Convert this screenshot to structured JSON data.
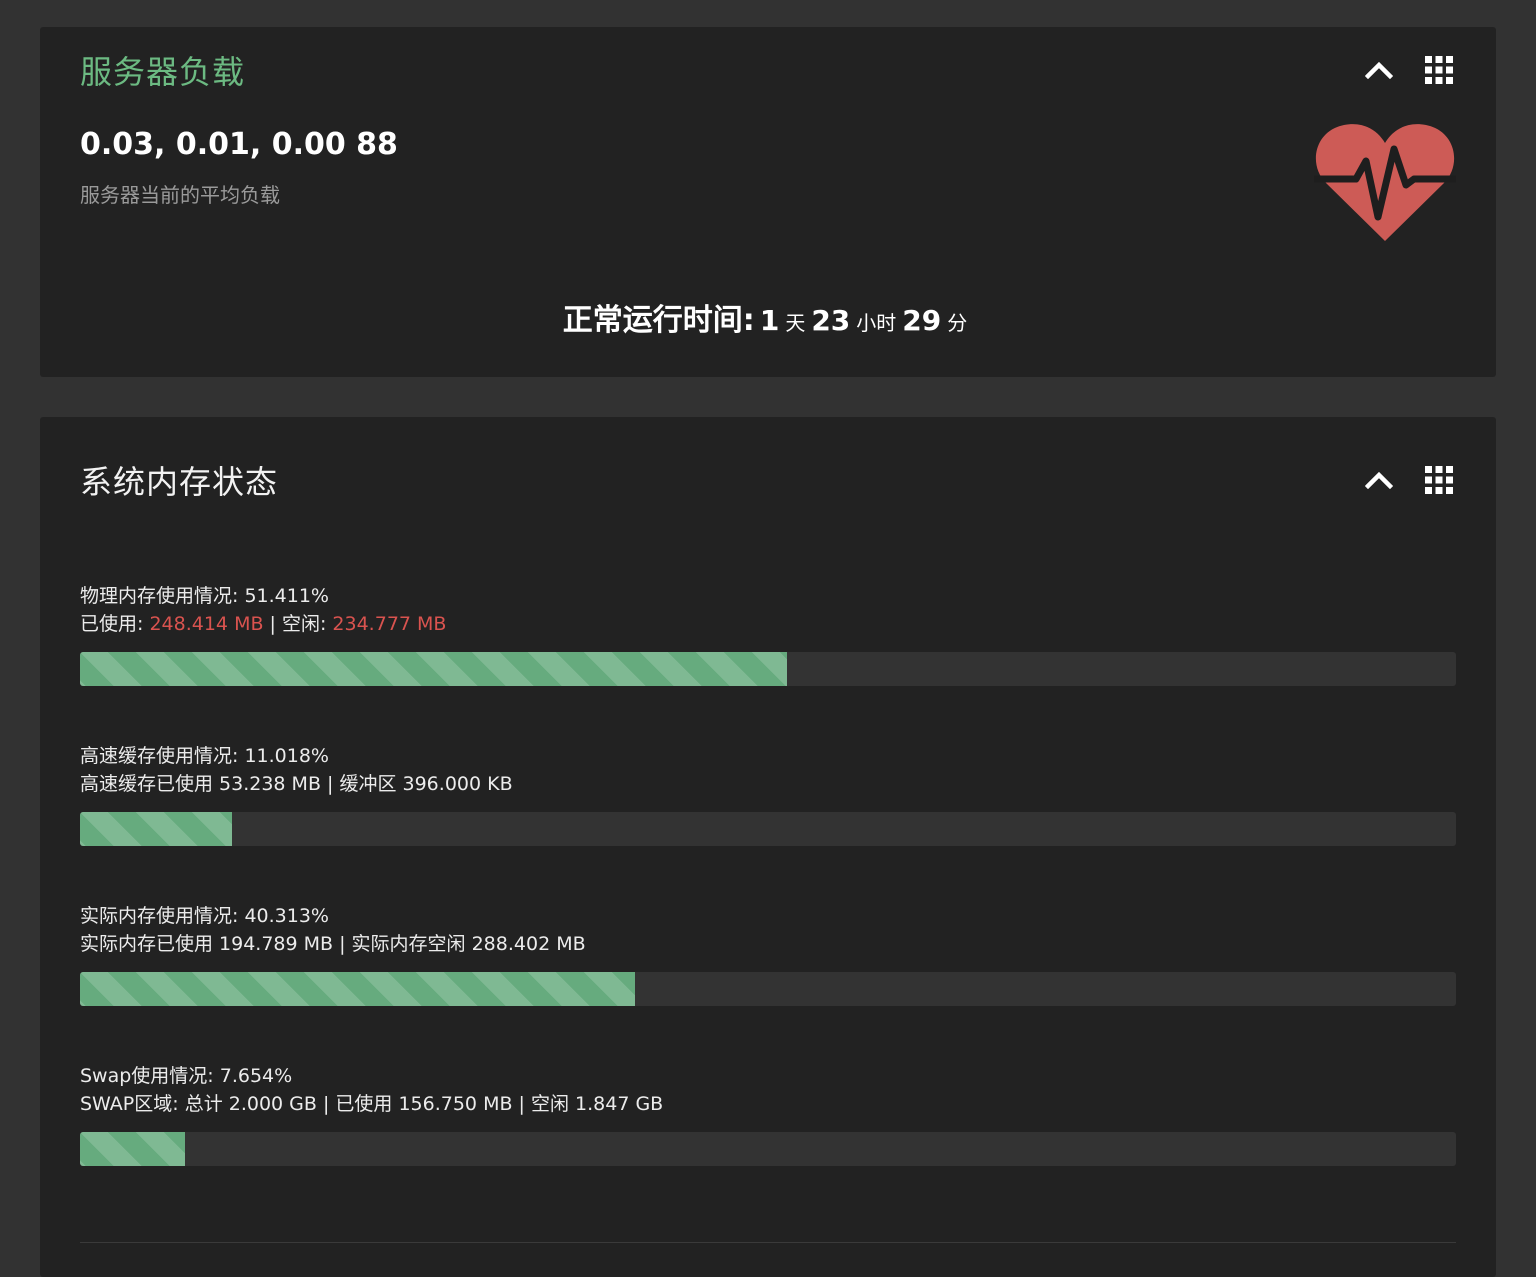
{
  "colors": {
    "page_bg": "#323232",
    "panel_bg": "#222222",
    "accent_green": "#6cba82",
    "bar_fill": "#66ab7e",
    "bar_track": "#333333",
    "highlight_red": "#d9534f",
    "heart_red": "#cd5b56"
  },
  "icons": {
    "collapse": "chevron-up-icon",
    "grid": "grid-icon",
    "heart": "heartbeat-icon"
  },
  "server_load": {
    "title": "服务器负载",
    "values": "0.03, 0.01, 0.00 88",
    "description": "服务器当前的平均负载",
    "uptime": {
      "label": "正常运行时间:",
      "days": "1",
      "days_unit": "天",
      "hours": "23",
      "hours_unit": "小时",
      "minutes": "29",
      "minutes_unit": "分"
    }
  },
  "memory": {
    "title": "系统内存状态",
    "items": [
      {
        "line1": "物理内存使用情况: 51.411%",
        "used_label": "已使用: ",
        "used_value": "248.414 MB",
        "sep": " | 空闲: ",
        "free_value": "234.777 MB",
        "percent": 51.411
      },
      {
        "line1": "高速缓存使用情况: 11.018%",
        "line2": "高速缓存已使用 53.238 MB | 缓冲区 396.000 KB",
        "percent": 11.018
      },
      {
        "line1": "实际内存使用情况: 40.313%",
        "line2": "实际内存已使用 194.789 MB | 实际内存空闲 288.402 MB",
        "percent": 40.313
      },
      {
        "line1": "Swap使用情况: 7.654%",
        "line2": "SWAP区域: 总计 2.000 GB | 已使用 156.750 MB | 空闲 1.847 GB",
        "percent": 7.654
      }
    ]
  }
}
